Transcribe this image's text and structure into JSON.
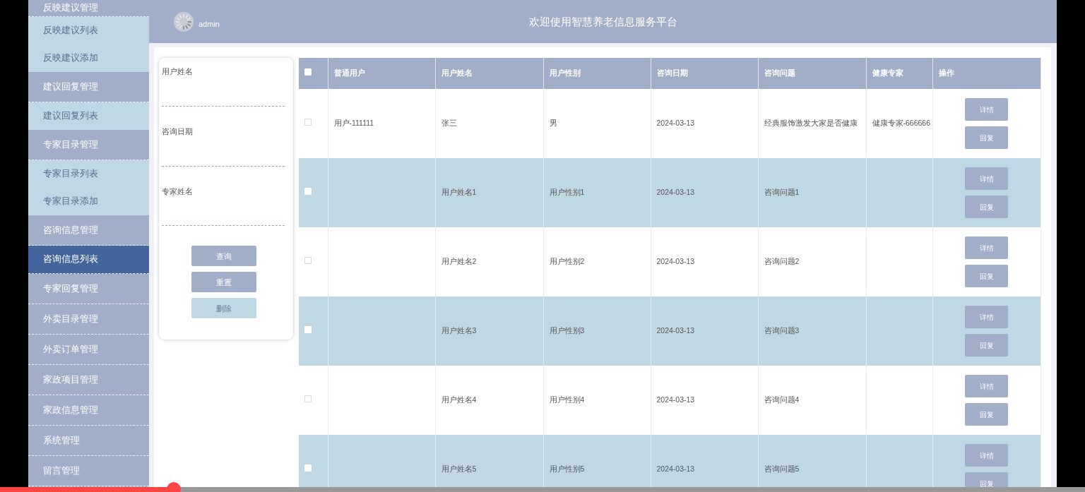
{
  "sidebar": {
    "items": [
      {
        "label": "反映建议管理",
        "kind": "group",
        "selected": false
      },
      {
        "label": "反映建议列表",
        "kind": "sub",
        "selected": false
      },
      {
        "label": "反映建议添加",
        "kind": "sub",
        "selected": false
      },
      {
        "label": "建议回复管理",
        "kind": "group",
        "selected": false
      },
      {
        "label": "建议回复列表",
        "kind": "sub",
        "selected": false
      },
      {
        "label": "专家目录管理",
        "kind": "group",
        "selected": false
      },
      {
        "label": "专家目录列表",
        "kind": "sub",
        "selected": false
      },
      {
        "label": "专家目录添加",
        "kind": "sub",
        "selected": false
      },
      {
        "label": "咨询信息管理",
        "kind": "group",
        "selected": false
      },
      {
        "label": "咨询信息列表",
        "kind": "sub",
        "selected": true
      },
      {
        "label": "专家回复管理",
        "kind": "group",
        "selected": false
      },
      {
        "label": "外卖目录管理",
        "kind": "group",
        "selected": false
      },
      {
        "label": "外卖订单管理",
        "kind": "group",
        "selected": false
      },
      {
        "label": "家政项目管理",
        "kind": "group",
        "selected": false
      },
      {
        "label": "家政信息管理",
        "kind": "group",
        "selected": false
      },
      {
        "label": "系统管理",
        "kind": "group",
        "selected": false
      },
      {
        "label": "留言管理",
        "kind": "group",
        "selected": false
      }
    ]
  },
  "header": {
    "username": "admin",
    "title": "欢迎使用智慧养老信息服务平台"
  },
  "search": {
    "fields": [
      {
        "label": "用户姓名"
      },
      {
        "label": "咨询日期"
      },
      {
        "label": "专家姓名"
      }
    ],
    "buttons": [
      {
        "label": "查询",
        "disabled": false
      },
      {
        "label": "重置",
        "disabled": false
      },
      {
        "label": "删除",
        "disabled": true
      }
    ]
  },
  "table": {
    "header_checkbox": {
      "checked": false
    },
    "columns": [
      "普通用户",
      "用户姓名",
      "用户性别",
      "咨询日期",
      "咨询问题",
      "健康专家",
      "操作"
    ],
    "rows": [
      {
        "checked": false,
        "cells": [
          "用户-111111",
          "张三",
          "男",
          "2024-03-13",
          "经典服饰激发大家是否健康",
          "健康专家-666666"
        ],
        "actions": [
          "详情",
          "回复"
        ]
      },
      {
        "checked": false,
        "cells": [
          "",
          "用户姓名1",
          "用户性别1",
          "2024-03-13",
          "咨询问题1",
          ""
        ],
        "actions": [
          "详情",
          "回复"
        ]
      },
      {
        "checked": false,
        "cells": [
          "",
          "用户姓名2",
          "用户性别2",
          "2024-03-13",
          "咨询问题2",
          ""
        ],
        "actions": [
          "详情",
          "回复"
        ]
      },
      {
        "checked": false,
        "cells": [
          "",
          "用户姓名3",
          "用户性别3",
          "2024-03-13",
          "咨询问题3",
          ""
        ],
        "actions": [
          "详情",
          "回复"
        ]
      },
      {
        "checked": false,
        "cells": [
          "",
          "用户姓名4",
          "用户性别4",
          "2024-03-13",
          "咨询问题4",
          ""
        ],
        "actions": [
          "详情",
          "回复"
        ]
      },
      {
        "checked": false,
        "cells": [
          "",
          "用户姓名5",
          "用户性别5",
          "2024-03-13",
          "咨询问题5",
          ""
        ],
        "actions": [
          "详情",
          "回复"
        ]
      }
    ]
  },
  "video_progress": {
    "level": 0.16
  }
}
